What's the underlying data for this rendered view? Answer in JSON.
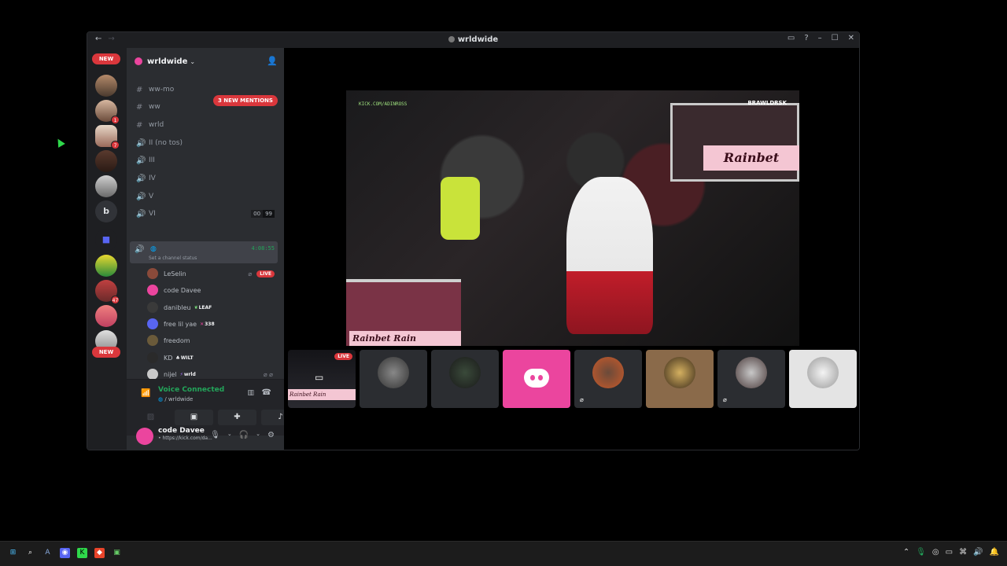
{
  "window": {
    "title": "wrldwide",
    "back": "←",
    "forward": "→",
    "inbox_icon": "inbox-icon",
    "help": "?",
    "minimize": "–",
    "maximize": "☐",
    "close": "✕"
  },
  "guilds": {
    "new_top": "NEW",
    "new_bottom": "NEW",
    "letter_server": "b",
    "badges": [
      "1",
      "7",
      "47"
    ]
  },
  "server": {
    "name": "wrldwide",
    "mentions": "3 NEW MENTIONS"
  },
  "channels": [
    {
      "icon": "#",
      "name": "ww-mo"
    },
    {
      "icon": "#",
      "name": "ww"
    },
    {
      "icon": "#",
      "name": "wrld"
    },
    {
      "icon": "🔊",
      "name": "II (no tos)"
    },
    {
      "icon": "🔊",
      "name": "III"
    },
    {
      "icon": "🔊",
      "name": "IV"
    },
    {
      "icon": "🔊",
      "name": "V"
    },
    {
      "icon": "🔊",
      "name": "VI",
      "count_a": "00",
      "count_b": "99"
    }
  ],
  "active_voice": {
    "timer": "4:08:55",
    "status_placeholder": "Set a channel status"
  },
  "voice_users": [
    {
      "name": "LeSelin",
      "badge": "LIVE",
      "color": "#8a4a3a"
    },
    {
      "name": "code Davee",
      "color": "#eb459e"
    },
    {
      "name": "danibleu",
      "tag": "LEAF",
      "color": "#3a3a3a"
    },
    {
      "name": "free lil yae",
      "tag": "338",
      "color": "#5865f2"
    },
    {
      "name": "freedom",
      "color": "#6a5a3a"
    },
    {
      "name": "KD",
      "tag": "WILT",
      "color": "#2a2a2a"
    },
    {
      "name": "nijel",
      "tag": "wrld",
      "color": "#c9c9c9"
    }
  ],
  "voice_panel": {
    "title": "Voice Connected",
    "subtitle": "/ wrldwide"
  },
  "user": {
    "name": "code Davee",
    "status": "• https://kick.com/da..."
  },
  "stream": {
    "watermark": "KICK.COM/ADINROSS",
    "brand": "BRAWLDRSK",
    "sign_right": "Rainbet",
    "sign_left": "Rainbet  Rain"
  },
  "tiles": {
    "live_label": "LIVE",
    "thumb_sign": "Rainbet Rain"
  },
  "colors": {
    "accent_green": "#23a55a",
    "danger_red": "#da373c",
    "discord_pink": "#eb459e"
  }
}
